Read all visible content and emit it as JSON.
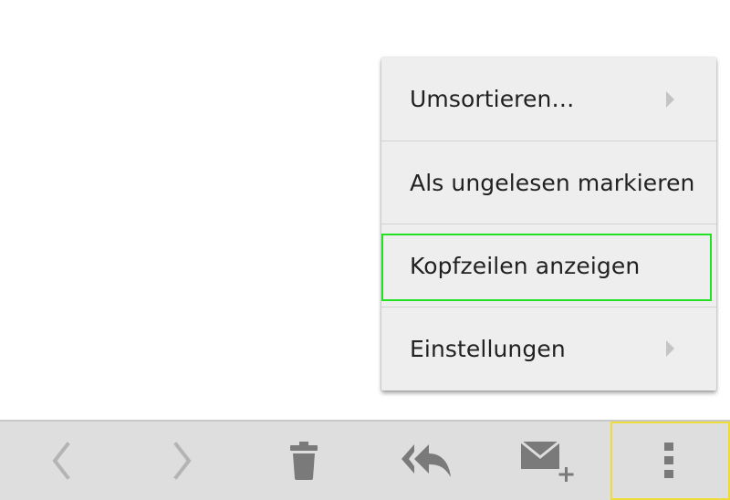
{
  "menu": {
    "items": [
      {
        "label": "Umsortieren…",
        "has_submenu": true
      },
      {
        "label": "Als ungelesen markieren",
        "has_submenu": false
      },
      {
        "label": "Kopfzeilen anzeigen",
        "has_submenu": false,
        "highlighted": true
      },
      {
        "label": "Einstellungen",
        "has_submenu": true
      }
    ]
  },
  "bottom_bar": {
    "buttons": [
      {
        "icon": "chevron-left-icon",
        "enabled": false
      },
      {
        "icon": "chevron-right-icon",
        "enabled": false
      },
      {
        "icon": "trash-icon",
        "enabled": true
      },
      {
        "icon": "reply-all-icon",
        "enabled": true
      },
      {
        "icon": "compose-mail-icon",
        "enabled": true
      },
      {
        "icon": "more-vertical-icon",
        "enabled": true,
        "highlighted": true
      }
    ]
  },
  "colors": {
    "icon_active": "#7a7a7a",
    "icon_disabled": "#b4b4b4",
    "highlight_green": "#22e022",
    "highlight_yellow": "#eedc3a"
  }
}
